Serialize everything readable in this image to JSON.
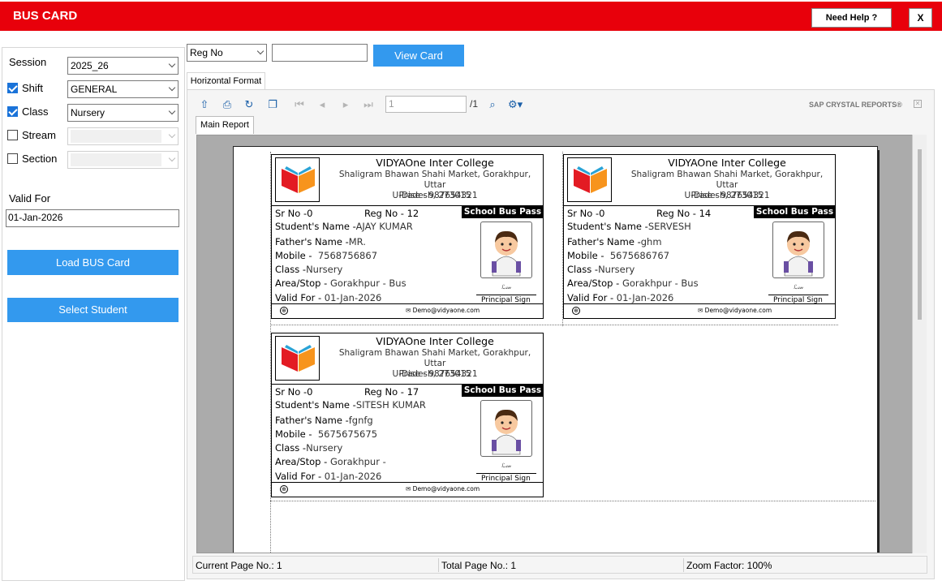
{
  "window": {
    "title": "BUS CARD",
    "help_label": "Need Help ?",
    "close_label": "X"
  },
  "filters": {
    "session_label": "Session",
    "session_value": "2025_26",
    "shift_label": "Shift",
    "shift_value": "GENERAL",
    "shift_checked": true,
    "class_label": "Class",
    "class_value": "Nursery",
    "class_checked": true,
    "stream_label": "Stream",
    "stream_checked": false,
    "section_label": "Section",
    "section_checked": false,
    "valid_for_label": "Valid For",
    "valid_for_value": "01-Jan-2026",
    "load_button": "Load BUS Card",
    "select_button": "Select Student"
  },
  "search": {
    "field_value": "Reg No",
    "input_value": "",
    "view_button": "View Card"
  },
  "tabs": {
    "format_tab": "Horizontal Format",
    "report_tab": "Main Report"
  },
  "viewer": {
    "page_input": "1",
    "total_pages": "/1",
    "brand": "SAP CRYSTAL REPORTS®",
    "status_current": "Current Page No.: 1",
    "status_total": "Total Page No.: 1",
    "status_zoom": "Zoom Factor: 100%"
  },
  "school": {
    "name": "VIDYAOne Inter College",
    "address_line1": "Shaligram Bhawan Shahi Market, Gorakhpur, Uttar",
    "address_line2": "Pradesh, 273015",
    "dise": "U-Dise - 987654321",
    "pass_title": "School Bus Pass",
    "principal_sign": "Principal Sign",
    "email": "Demo@vidyaone.com"
  },
  "labels": {
    "student_name": "Student's Name -",
    "father_name": "Father's Name -",
    "mobile": "Mobile -",
    "class": "Class -",
    "area_stop": "Area/Stop -",
    "valid_for": "Valid For -"
  },
  "cards": [
    {
      "sr_no": "Sr No -0",
      "reg_no": "Reg No -  12",
      "student_name": "AJAY KUMAR",
      "father_name": "MR.",
      "mobile": "7568756867",
      "class": "Nursery",
      "area_stop": "Gorakhpur - Bus",
      "valid_for": "01-Jan-2026"
    },
    {
      "sr_no": "Sr No -0",
      "reg_no": "Reg No -  14",
      "student_name": "SERVESH",
      "father_name": "ghm",
      "mobile": "5675686767",
      "class": "Nursery",
      "area_stop": "Gorakhpur - Bus",
      "valid_for": "01-Jan-2026"
    },
    {
      "sr_no": "Sr No -0",
      "reg_no": "Reg No -  17",
      "student_name": "SITESH KUMAR",
      "father_name": "fgnfg",
      "mobile": "5675675675",
      "class": "Nursery",
      "area_stop": "Gorakhpur -",
      "valid_for": "01-Jan-2026"
    }
  ],
  "colors": {
    "title_bar": "#e8000b",
    "button_blue": "#3399ee",
    "checkbox_blue": "#1a73d9"
  }
}
